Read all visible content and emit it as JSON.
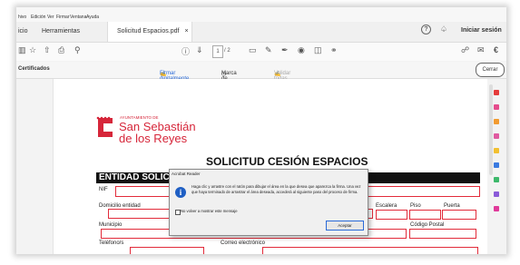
{
  "menubar": {
    "items": [
      "hivo",
      "Edición",
      "Ver",
      "Firmar",
      "Ventana",
      "Ayuda"
    ]
  },
  "tabs": {
    "home": "icio",
    "tools": "Herramientas",
    "document": "Solicitud Espacios.pdf",
    "close": "×"
  },
  "header": {
    "signin": "Iniciar sesión"
  },
  "toolbar": {
    "page_current": "1",
    "page_total": "/ 2"
  },
  "certbar": {
    "title": "Certificados",
    "sign_digitally": "Firmar digitalmente",
    "timestamp": "Marca de hora",
    "validate_all": "Validar todas las firmas",
    "close_button": "Cerrar"
  },
  "document": {
    "logo_line1": "AYUNTAMIENTO DE",
    "logo_line2": "San Sebastián",
    "logo_line3": "de los Reyes",
    "title": "SOLICITUD CESIÓN ESPACIOS",
    "section_heading": "ENTIDAD SOLICITANTE",
    "labels": {
      "nif": "NIF",
      "domicilio": "Domicilio entidad",
      "escalera": "Escalera",
      "piso": "Piso",
      "puerta": "Puerta",
      "municipio": "Municipio",
      "codigo_postal": "Código Postal",
      "telefonos": "Teléfono/s",
      "correo": "Correo electrónico"
    }
  },
  "dialog": {
    "title": "Acrobat Reader",
    "message": "Haga clic y arrastre con el ratón para dibujar el área en la que desea que aparezca la firma. Una vez que haya terminado de arrastrar el área deseada, accederá al siguiente paso del proceso de firma.",
    "checkbox_label": "No volver a mostrar este mensaje",
    "accept_button": "Aceptar"
  },
  "colors": {
    "brand_red": "#d6263a",
    "field_red": "#e22b3a",
    "accent_blue": "#2a6ad8"
  },
  "icons": {
    "toolbar": [
      "save-icon",
      "star-icon",
      "upload-icon",
      "print-icon",
      "search-icon",
      "help-icon",
      "down-icon",
      "comment-icon",
      "pen-icon",
      "sign-icon",
      "stamp-icon",
      "delete-icon",
      "headphones-icon",
      "share-icon",
      "mail-icon"
    ],
    "right_pane": [
      "pdf-icon",
      "comment-icon",
      "edit-icon",
      "export-icon",
      "organize-icon",
      "enhance-icon",
      "protect-icon",
      "fill-sign-icon",
      "more-tools-icon"
    ]
  }
}
